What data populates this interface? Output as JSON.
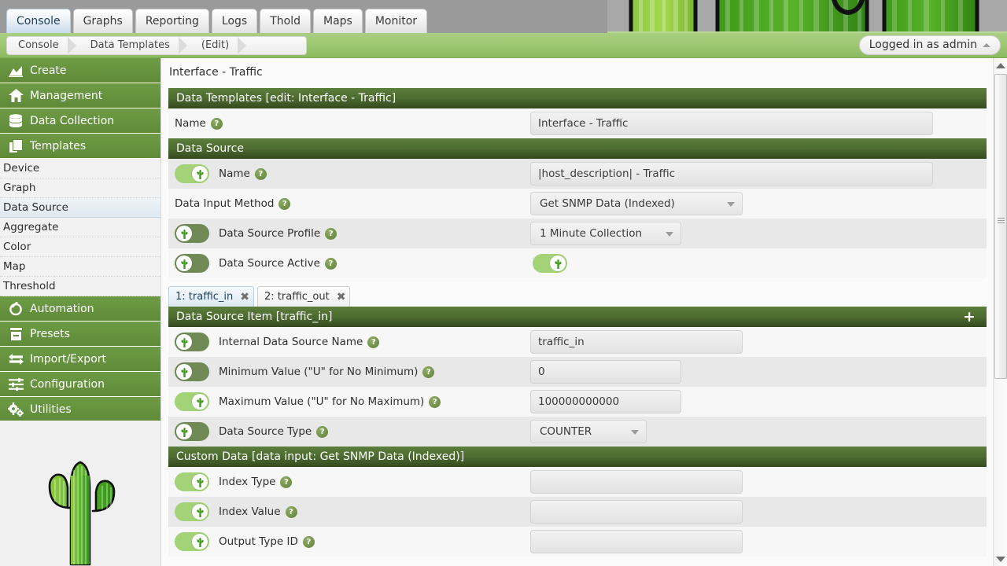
{
  "topnav": {
    "tabs": [
      {
        "label": "Console",
        "active": true
      },
      {
        "label": "Graphs",
        "active": false
      },
      {
        "label": "Reporting",
        "active": false
      },
      {
        "label": "Logs",
        "active": false
      },
      {
        "label": "Thold",
        "active": false
      },
      {
        "label": "Maps",
        "active": false
      },
      {
        "label": "Monitor",
        "active": false
      }
    ]
  },
  "breadcrumb": {
    "items": [
      "Console",
      "Data Templates",
      "(Edit)"
    ]
  },
  "user": {
    "login_label": "Logged in as admin"
  },
  "sidebar": {
    "groups": [
      {
        "label": "Create",
        "icon": "chart-area-icon"
      },
      {
        "label": "Management",
        "icon": "home-icon"
      },
      {
        "label": "Data Collection",
        "icon": "database-icon"
      },
      {
        "label": "Templates",
        "icon": "copy-icon"
      }
    ],
    "template_items": [
      {
        "label": "Device",
        "selected": false
      },
      {
        "label": "Graph",
        "selected": false
      },
      {
        "label": "Data Source",
        "selected": true
      },
      {
        "label": "Aggregate",
        "selected": false
      },
      {
        "label": "Color",
        "selected": false
      },
      {
        "label": "Map",
        "selected": false
      },
      {
        "label": "Threshold",
        "selected": false
      }
    ],
    "groups2": [
      {
        "label": "Automation",
        "icon": "automation-icon"
      },
      {
        "label": "Presets",
        "icon": "presets-icon"
      },
      {
        "label": "Import/Export",
        "icon": "import-export-icon"
      },
      {
        "label": "Configuration",
        "icon": "sliders-icon"
      },
      {
        "label": "Utilities",
        "icon": "gears-icon"
      }
    ]
  },
  "main": {
    "page_title": "Interface - Traffic",
    "sections": {
      "data_templates": {
        "header": "Data Templates [edit: Interface - Traffic]",
        "name_label": "Name",
        "name_value": "Interface - Traffic"
      },
      "data_source": {
        "header": "Data Source",
        "rows": [
          {
            "label": "Name",
            "toggle": "on",
            "value": "|host_description| - Traffic",
            "control": "text"
          },
          {
            "label": "Data Input Method",
            "toggle": "none",
            "value": "Get SNMP Data (Indexed)",
            "control": "dropdown"
          },
          {
            "label": "Data Source Profile",
            "toggle": "off",
            "value": "1 Minute Collection",
            "control": "dropdown"
          },
          {
            "label": "Data Source Active",
            "toggle": "off",
            "value": "",
            "control": "switch"
          }
        ]
      },
      "item_tabs": [
        {
          "label": "1: traffic_in",
          "active": true,
          "close": "✖"
        },
        {
          "label": "2: traffic_out",
          "active": false,
          "close": "✖"
        }
      ],
      "data_source_item": {
        "header": "Data Source Item [traffic_in]",
        "add_label": "+",
        "rows": [
          {
            "label": "Internal Data Source Name",
            "toggle": "off",
            "value": "traffic_in",
            "control": "text"
          },
          {
            "label": "Minimum Value (\"U\" for No Minimum)",
            "toggle": "off",
            "value": "0",
            "control": "text"
          },
          {
            "label": "Maximum Value (\"U\" for No Maximum)",
            "toggle": "on",
            "value": "100000000000",
            "control": "text"
          },
          {
            "label": "Data Source Type",
            "toggle": "off",
            "value": "COUNTER",
            "control": "dropdown"
          }
        ]
      },
      "custom_data": {
        "header": "Custom Data [data input: Get SNMP Data (Indexed)]",
        "rows": [
          {
            "label": "Index Type",
            "toggle": "on",
            "value": "",
            "control": "text"
          },
          {
            "label": "Index Value",
            "toggle": "on",
            "value": "",
            "control": "text"
          },
          {
            "label": "Output Type ID",
            "toggle": "on",
            "value": "",
            "control": "text"
          }
        ]
      }
    }
  },
  "icons": {
    "help": "?",
    "caret_up": "▲"
  },
  "colors": {
    "accent_green": "#6e9b45",
    "header_green": "#4c6b30",
    "crumb_green": "#9cc671",
    "toggle_on": "#a3d278",
    "toggle_off": "#6f8a54"
  }
}
